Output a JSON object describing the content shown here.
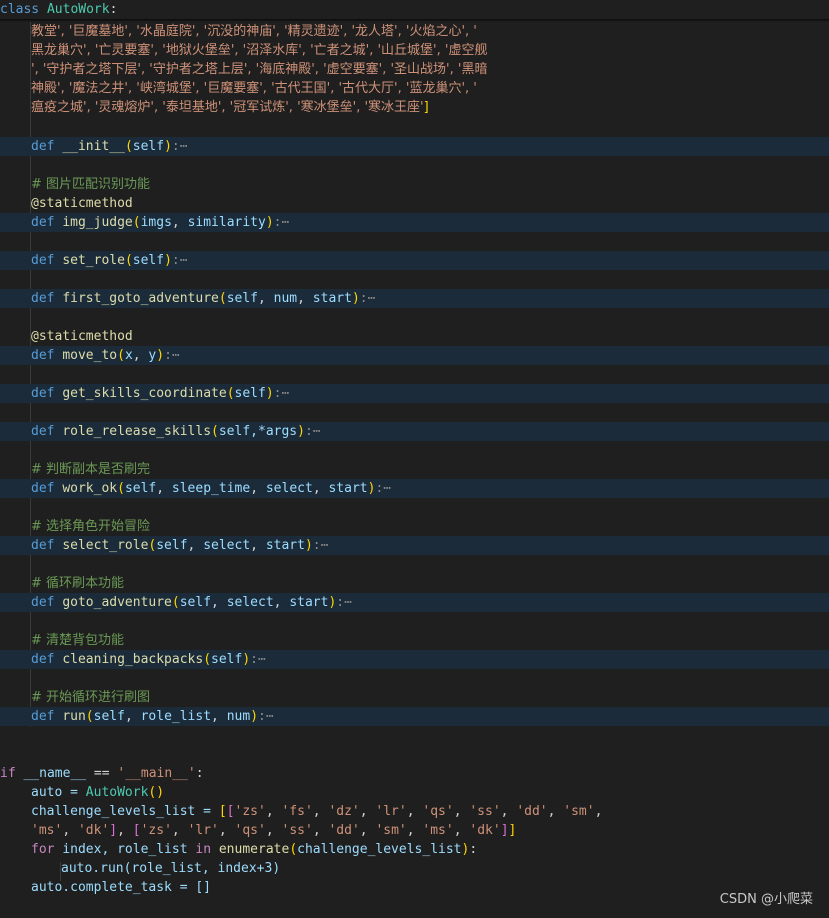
{
  "sticky_header": {
    "keyword": "class",
    "name": "AutoWork",
    "colon": ":"
  },
  "string_lines": [
    "教堂', '巨魔墓地', '水晶庭院', '沉没的神庙', '精灵遗迹', '龙人塔', '火焰之心', '",
    "黑龙巢穴', '亡灵要塞', '地狱火堡垒', '沼泽水库', '亡者之城', '山丘城堡', '虚空舰",
    "', '守护者之塔下层', '守护者之塔上层', '海底神殿', '虚空要塞', '圣山战场', '黑暗",
    "神殿', '魔法之井', '峡湾城堡', '巨魔要塞', '古代王国', '古代大厅', '蓝龙巢穴', '",
    "瘟疫之城', '灵魂熔炉', '泰坦基地', '冠军试炼', '寒冰堡垒', '寒冰王座'"
  ],
  "closing_bracket": "]",
  "methods": {
    "init": {
      "def": "def",
      "name": "__init__",
      "params": "self",
      "fold": ":⋯"
    },
    "comment_img": "# 图片匹配识别功能",
    "decorator1": "@staticmethod",
    "img_judge": {
      "def": "def",
      "name": "img_judge",
      "params": [
        "imgs",
        "similarity"
      ],
      "fold": ":⋯"
    },
    "set_role": {
      "def": "def",
      "name": "set_role",
      "params": "self",
      "fold": ":⋯"
    },
    "first_goto": {
      "def": "def",
      "name": "first_goto_adventure",
      "params": [
        "self",
        "num",
        "start"
      ],
      "fold": ":⋯"
    },
    "decorator2": "@staticmethod",
    "move_to": {
      "def": "def",
      "name": "move_to",
      "params": [
        "x",
        "y"
      ],
      "fold": ":⋯"
    },
    "get_skills": {
      "def": "def",
      "name": "get_skills_coordinate",
      "params": "self",
      "fold": ":⋯"
    },
    "role_release": {
      "def": "def",
      "name": "role_release_skills",
      "params": "self,*args",
      "fold": ":⋯"
    },
    "comment_work": "# 判断副本是否刷完",
    "work_ok": {
      "def": "def",
      "name": "work_ok",
      "params": [
        "self",
        "sleep_time",
        "select",
        "start"
      ],
      "fold": ":⋯"
    },
    "comment_select": "# 选择角色开始冒险",
    "select_role": {
      "def": "def",
      "name": "select_role",
      "params": [
        "self",
        "select",
        "start"
      ],
      "fold": ":⋯"
    },
    "comment_loop": "# 循环刷本功能",
    "goto_adv": {
      "def": "def",
      "name": "goto_adventure",
      "params": [
        "self",
        "select",
        "start"
      ],
      "fold": ":⋯"
    },
    "comment_clean": "# 清楚背包功能",
    "cleaning": {
      "def": "def",
      "name": "cleaning_backpacks",
      "params": "self",
      "fold": ":⋯"
    },
    "comment_run": "# 开始循环进行刷图",
    "run": {
      "def": "def",
      "name": "run",
      "params": [
        "self",
        "role_list",
        "num"
      ],
      "fold": ":⋯"
    }
  },
  "main_block": {
    "if_kw": "if",
    "name_var": "__name__",
    "eq": " == ",
    "main_str": "'__main__'",
    "colon": ":",
    "auto_assign": "auto = ",
    "autowork_call": "AutoWork",
    "challenge_var": "challenge_levels_list = ",
    "list1": [
      "'zs'",
      "'fs'",
      "'dz'",
      "'lr'",
      "'qs'",
      "'ss'",
      "'dd'",
      "'sm'"
    ],
    "list1_tail": [
      "'ms'",
      "'dk'"
    ],
    "list2": [
      "'zs'",
      "'lr'",
      "'qs'",
      "'ss'",
      "'dd'",
      "'sm'",
      "'ms'",
      "'dk'"
    ],
    "for_kw": "for",
    "for_vars": "index, role_list",
    "in_kw": "in",
    "enumerate_fn": "enumerate",
    "enumerate_arg": "challenge_levels_list",
    "run_call": "auto.run(role_list, index+3)",
    "complete": "auto.complete_task = []"
  },
  "watermark": "CSDN @小爬菜"
}
